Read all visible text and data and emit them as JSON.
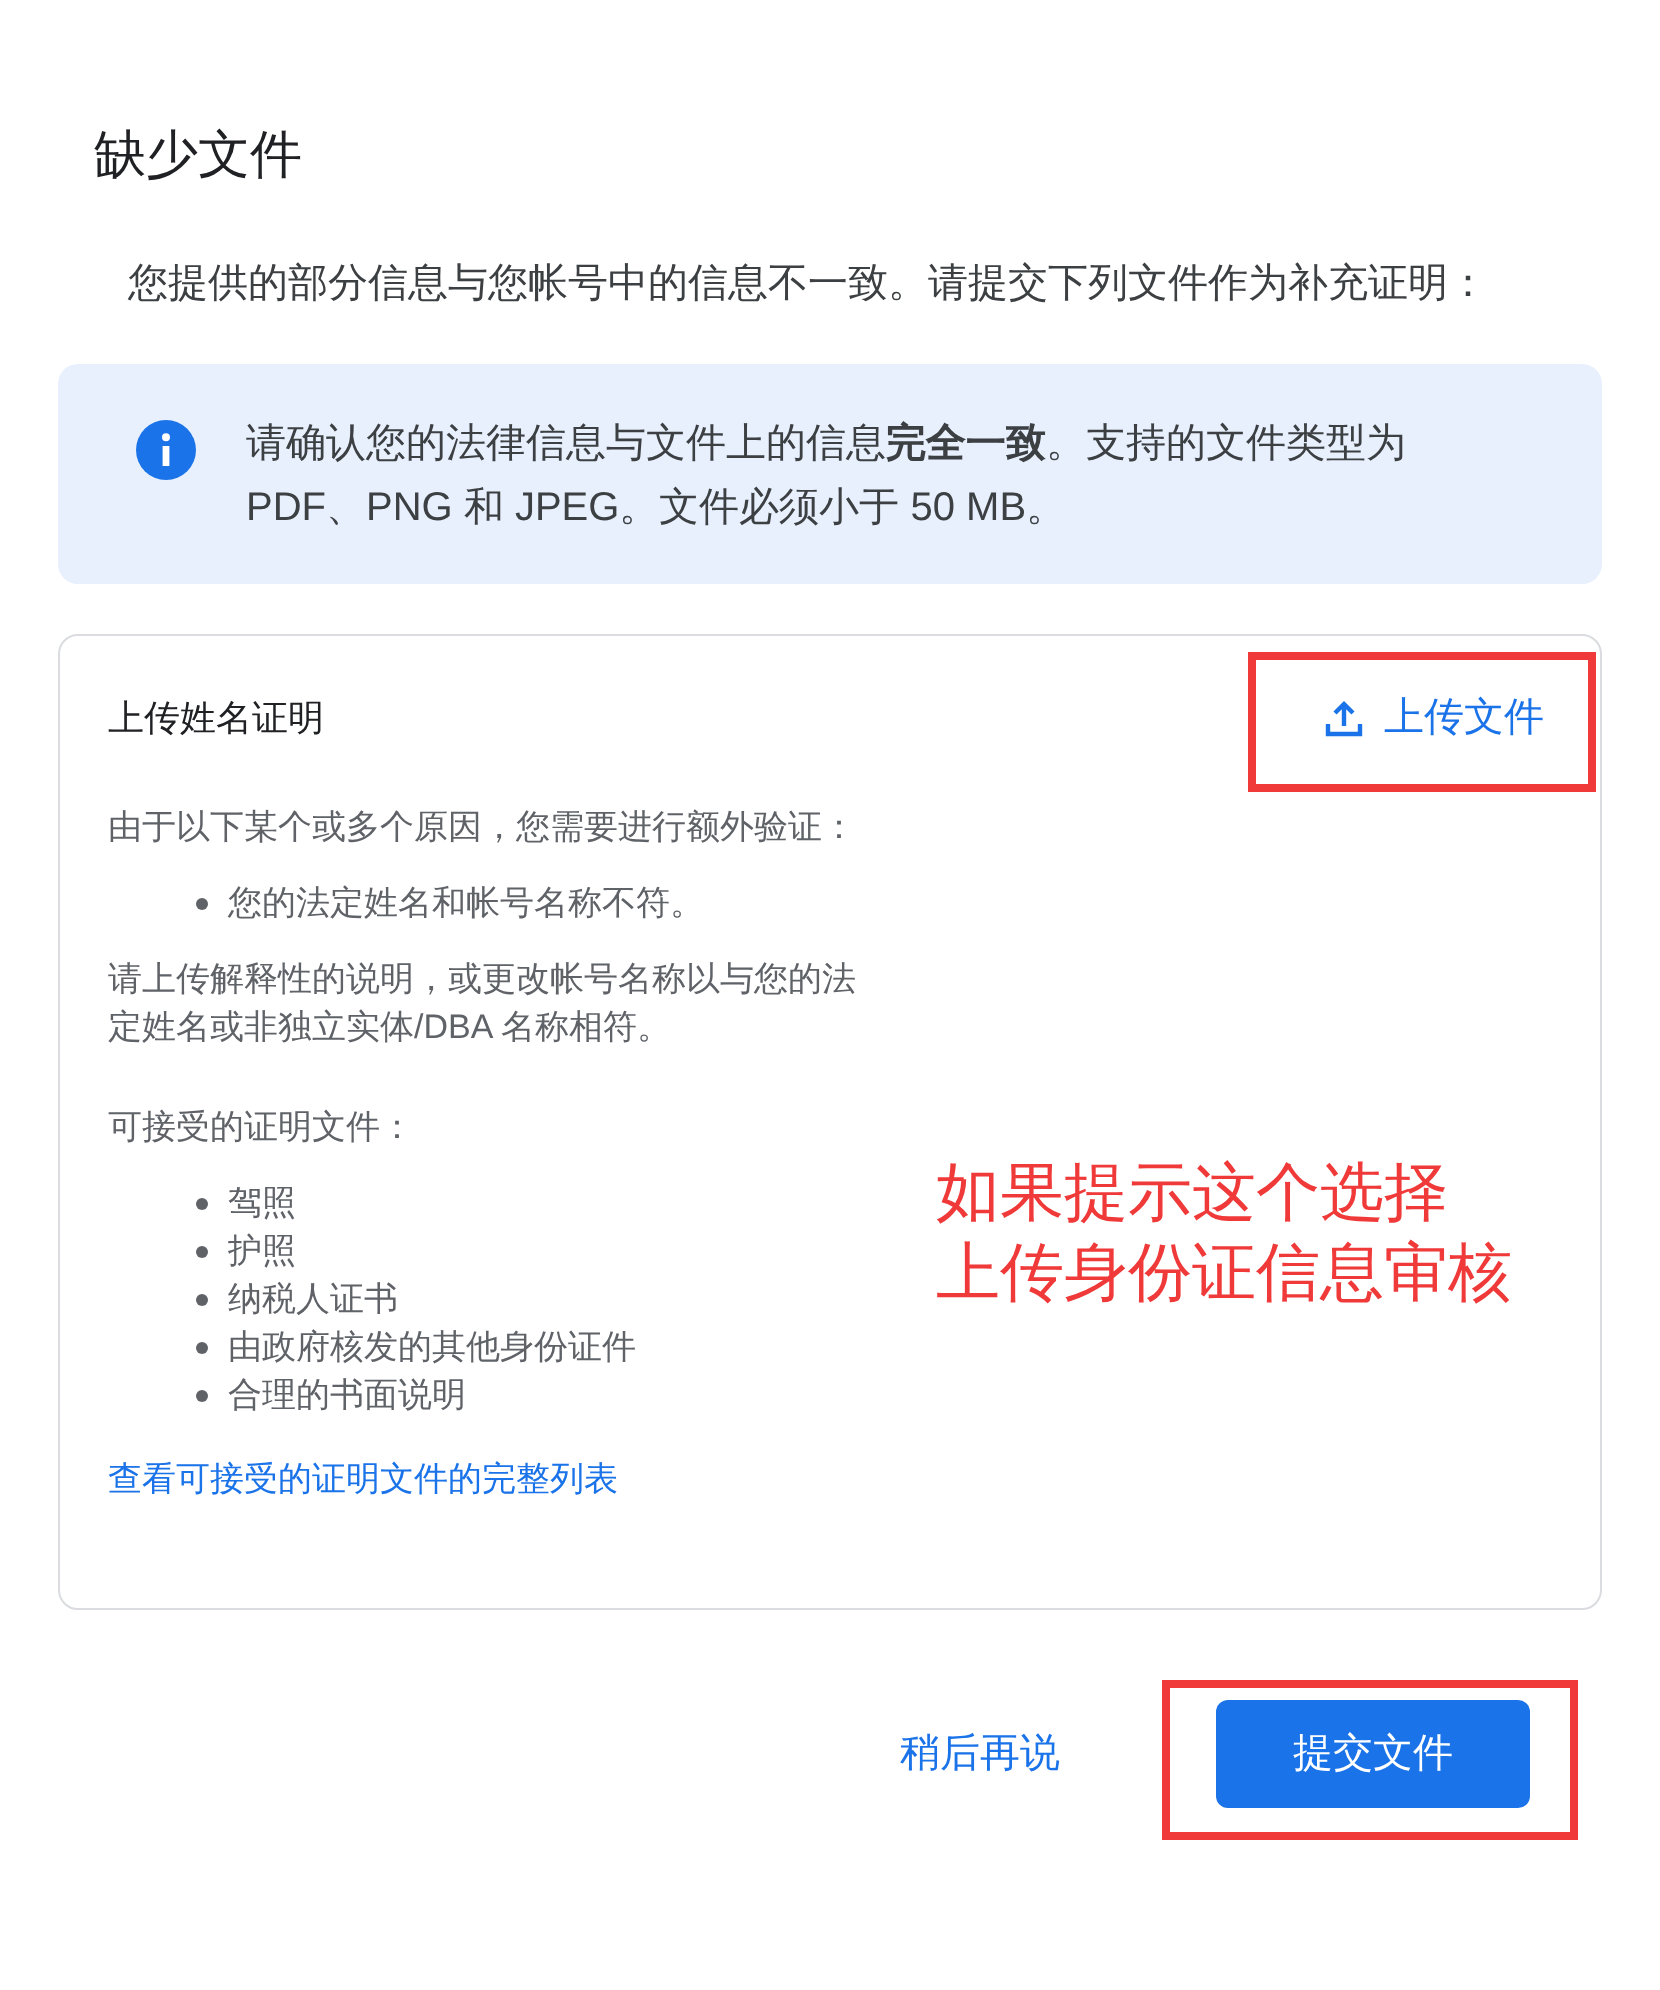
{
  "dialog": {
    "title": "缺少文件",
    "intro": "您提供的部分信息与您帐号中的信息不一致。请提交下列文件作为补充证明：",
    "notice": {
      "text": "请确认您的法律信息与文件上的信息**完全一致**。支持的文件类型为 PDF、PNG 和 JPEG。文件必须小于 50 MB。"
    },
    "document_card": {
      "title": "上传姓名证明",
      "upload_button": {
        "label": "上传文件",
        "highlighted": true
      },
      "reason_intro": "由于以下某个或多个原因，您需要进行额外验证：",
      "reasons": [
        "您的法定姓名和帐号名称不符。"
      ],
      "instruction": "请上传解释性的说明，或更改帐号名称以与您的法定姓名或非独立实体/DBA 名称相符。",
      "accepted_heading": "可接受的证明文件：",
      "accepted": [
        "驾照",
        "护照",
        "纳税人证书",
        "由政府核发的其他身份证件",
        "合理的书面说明"
      ],
      "link": "查看可接受的证明文件的完整列表"
    },
    "buttons": {
      "later": {
        "label": "稍后再说",
        "highlighted": false
      },
      "submit": {
        "label": "提交文件",
        "highlighted": true
      }
    }
  },
  "annotation": {
    "lines": [
      "如果提示这个选择",
      "上传身份证信息审核"
    ]
  }
}
